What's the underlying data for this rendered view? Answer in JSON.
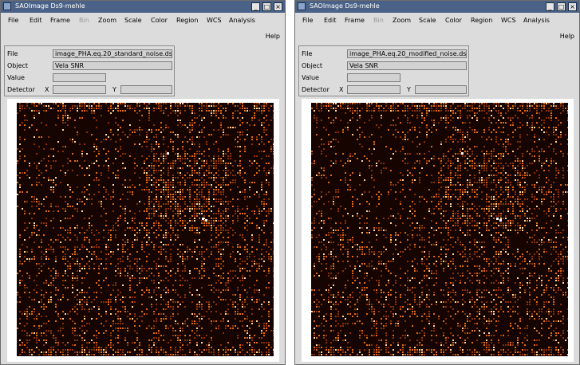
{
  "windows": [
    {
      "title": "SAOImage Ds9-mehle",
      "menu": [
        "File",
        "Edit",
        "Frame",
        "Bin",
        "Zoom",
        "Scale",
        "Color",
        "Region",
        "WCS",
        "Analysis"
      ],
      "menu_disabled": "Bin",
      "help": "Help",
      "info": {
        "file_label": "File",
        "file_value": "image_PHA.eq.20_standard_noise.ds",
        "object_label": "Object",
        "object_value": "Vela SNR",
        "value_label": "Value",
        "value_value": "",
        "detector_label": "Detector",
        "x_label": "X",
        "y_label": "Y",
        "x_value": "",
        "y_value": ""
      },
      "image_description": "orange noise image"
    },
    {
      "title": "SAOImage Ds9-mehle",
      "menu": [
        "File",
        "Edit",
        "Frame",
        "Bin",
        "Zoom",
        "Scale",
        "Color",
        "Region",
        "WCS",
        "Analysis"
      ],
      "menu_disabled": "Bin",
      "help": "Help",
      "info": {
        "file_label": "File",
        "file_value": "image_PHA.eq.20_modified_noise.ds",
        "object_label": "Object",
        "object_value": "Vela SNR",
        "value_label": "Value",
        "value_value": "",
        "detector_label": "Detector",
        "x_label": "X",
        "y_label": "Y",
        "x_value": "",
        "y_value": ""
      }
    }
  ],
  "colors": {
    "titlebar": "#4a6287",
    "window_bg": "#dcdcdc",
    "image_hot": "#e06a10"
  }
}
